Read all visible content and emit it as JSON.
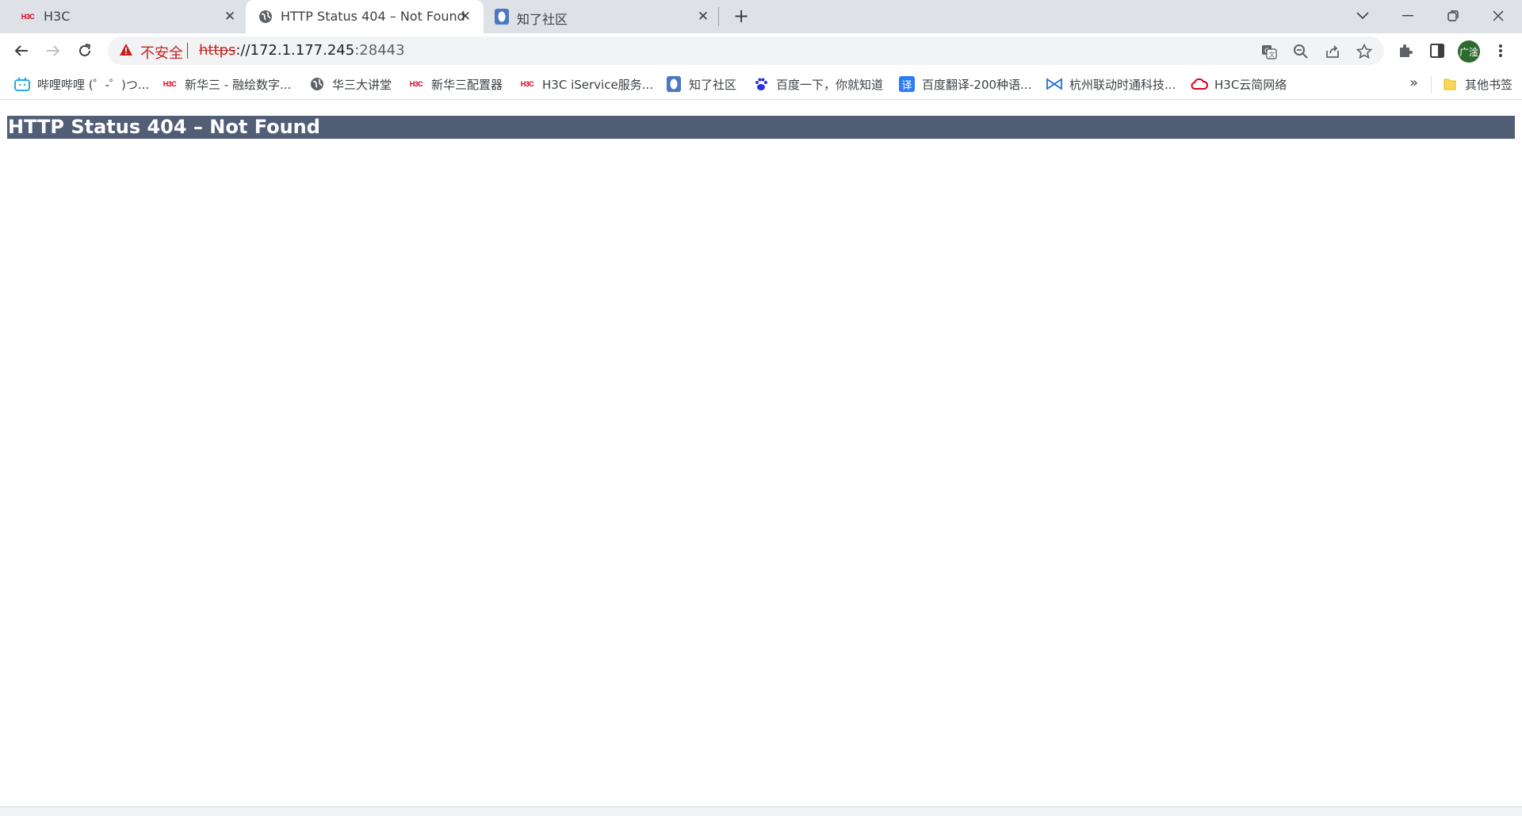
{
  "tabs": [
    {
      "title": "H3C",
      "favicon": "h3c-logo-icon",
      "favicon_text": "H3C",
      "active": false
    },
    {
      "title": "HTTP Status 404 – Not Found",
      "favicon": "globe-icon",
      "active": true
    },
    {
      "title": "知了社区",
      "favicon": "zhiliao-icon",
      "active": false
    }
  ],
  "omnibox": {
    "security_label": "不安全",
    "url_scheme": "https",
    "url_host": "://172.1.177.245",
    "url_port": ":28443"
  },
  "profile": {
    "avatar_text": "广淦"
  },
  "bookmarks": {
    "items": [
      {
        "label": "哔哩哔哩 (゜-゜)つ...",
        "icon": "bilibili-icon"
      },
      {
        "label": "新华三 - 融绘数字...",
        "icon": "h3c-logo-icon",
        "icon_text": "H3C"
      },
      {
        "label": "华三大讲堂",
        "icon": "globe-icon"
      },
      {
        "label": "新华三配置器",
        "icon": "h3c-logo-icon",
        "icon_text": "H3C"
      },
      {
        "label": "H3C iService服务...",
        "icon": "h3c-logo-icon",
        "icon_text": "H3C"
      },
      {
        "label": "知了社区",
        "icon": "zhiliao-icon"
      },
      {
        "label": "百度一下，你就知道",
        "icon": "baidu-icon"
      },
      {
        "label": "百度翻译-200种语...",
        "icon": "translate-icon",
        "icon_text": "译"
      },
      {
        "label": "杭州联动时通科技...",
        "icon": "liandong-icon"
      },
      {
        "label": "H3C云简网络",
        "icon": "cloud-icon"
      }
    ],
    "more": "»",
    "other_folder": "其他书签"
  },
  "page": {
    "heading": "HTTP Status 404 – Not Found"
  },
  "colors": {
    "heading_bg": "#525d76",
    "insecure_red": "#c5221f",
    "tabstrip_bg": "#dee1e6"
  }
}
